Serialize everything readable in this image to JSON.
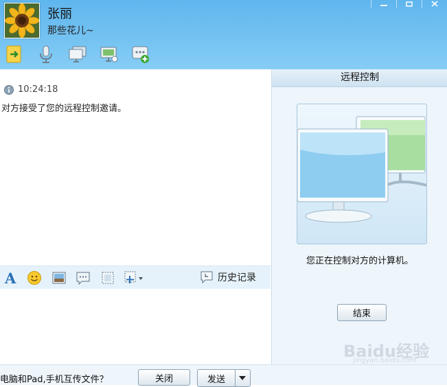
{
  "header": {
    "contact_name": "张丽",
    "contact_status": "那些花儿~",
    "avatar_icon": "sunflower-avatar",
    "window_controls": [
      "minimize-icon",
      "maximize-icon",
      "close-icon"
    ],
    "toolbar_icons": [
      "send-file-icon",
      "voice-call-icon",
      "video-call-icon",
      "remote-desktop-icon",
      "more-apps-icon"
    ]
  },
  "chat": {
    "message_time": "10:24:18",
    "message_text": "对方接受了您的远程控制邀请。"
  },
  "input_toolbar": {
    "icons": [
      "font-icon",
      "emoji-icon",
      "image-icon",
      "bubble-icon",
      "screenshot-icon",
      "more-tools-icon"
    ],
    "history_label": "历史记录"
  },
  "remote_panel": {
    "title": "远程控制",
    "status_text": "您正在控制对方的计算机。",
    "end_button_label": "结束"
  },
  "bottom_bar": {
    "file_transfer_text": "电脑和Pad,手机互传文件？",
    "close_button_label": "关闭",
    "send_button_label": "发送"
  },
  "watermark": {
    "logo_text": "Baidu经验",
    "sub_text": "jingyan.baidu.com"
  },
  "colors": {
    "header_blue": "#6dbdf0",
    "panel_bg": "#eef6fc",
    "toolbar_bg": "#e6f2fb"
  }
}
